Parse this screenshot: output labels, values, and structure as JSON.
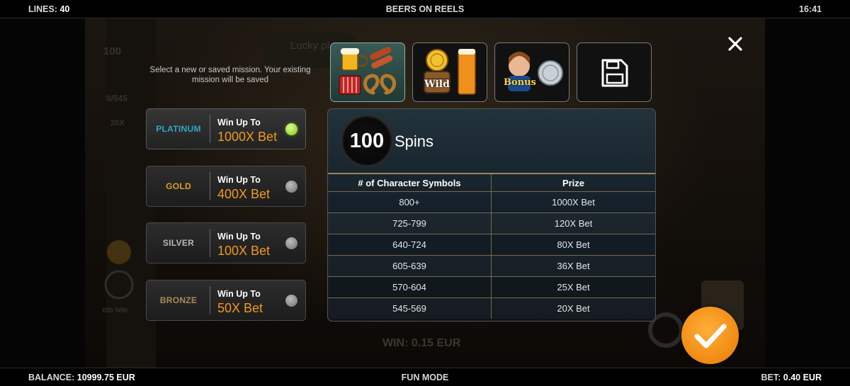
{
  "top_bar": {
    "lines_label": "LINES:",
    "lines_value": "40",
    "game_title": "BEERS ON REELS",
    "clock": "16:41"
  },
  "bottom_bar": {
    "balance_label": "BALANCE:",
    "balance_value": "10999.75 EUR",
    "mode": "FUN MODE",
    "bet_label": "BET:",
    "bet_value": "0.40 EUR"
  },
  "background": {
    "spin_counter": "100",
    "progress": "0/545",
    "multiplier": "20X",
    "banner": "Lucky pl",
    "big_win": "BIG WIN",
    "win_text": "WIN: 0.15 EUR"
  },
  "mission_help": "Select a new or saved mission. Your existing mission will be saved",
  "missions": [
    {
      "tier": "PLATINUM",
      "win_label": "Win Up To",
      "win_value": "1000X Bet",
      "selected": true
    },
    {
      "tier": "GOLD",
      "win_label": "Win Up To",
      "win_value": "400X Bet",
      "selected": false
    },
    {
      "tier": "SILVER",
      "win_label": "Win Up To",
      "win_value": "100X Bet",
      "selected": false
    },
    {
      "tier": "BRONZE",
      "win_label": "Win Up To",
      "win_value": "50X Bet",
      "selected": false
    }
  ],
  "tabs": [
    {
      "name": "character-symbols",
      "active": true
    },
    {
      "name": "wild-symbols",
      "wild_text": "Wild",
      "active": false
    },
    {
      "name": "bonus-symbols",
      "bonus_text": "Bonus",
      "active": false
    },
    {
      "name": "saved-mission",
      "icon": "floppy-disk-icon",
      "active": false
    }
  ],
  "panel": {
    "spins_value": "100",
    "spins_label": "Spins",
    "table": {
      "headers": [
        "# of Character Symbols",
        "Prize"
      ],
      "rows": [
        [
          "800+",
          "1000X Bet"
        ],
        [
          "725-799",
          "120X Bet"
        ],
        [
          "640-724",
          "80X Bet"
        ],
        [
          "605-639",
          "36X Bet"
        ],
        [
          "570-604",
          "25X Bet"
        ],
        [
          "545-569",
          "20X Bet"
        ]
      ]
    }
  },
  "colors": {
    "accent_orange": "#f09a1e",
    "platinum": "#33a6c8",
    "gold": "#d8a020",
    "silver": "#b9b9b9",
    "bronze": "#a88a5b",
    "selected_dot": "#7cc61d"
  }
}
